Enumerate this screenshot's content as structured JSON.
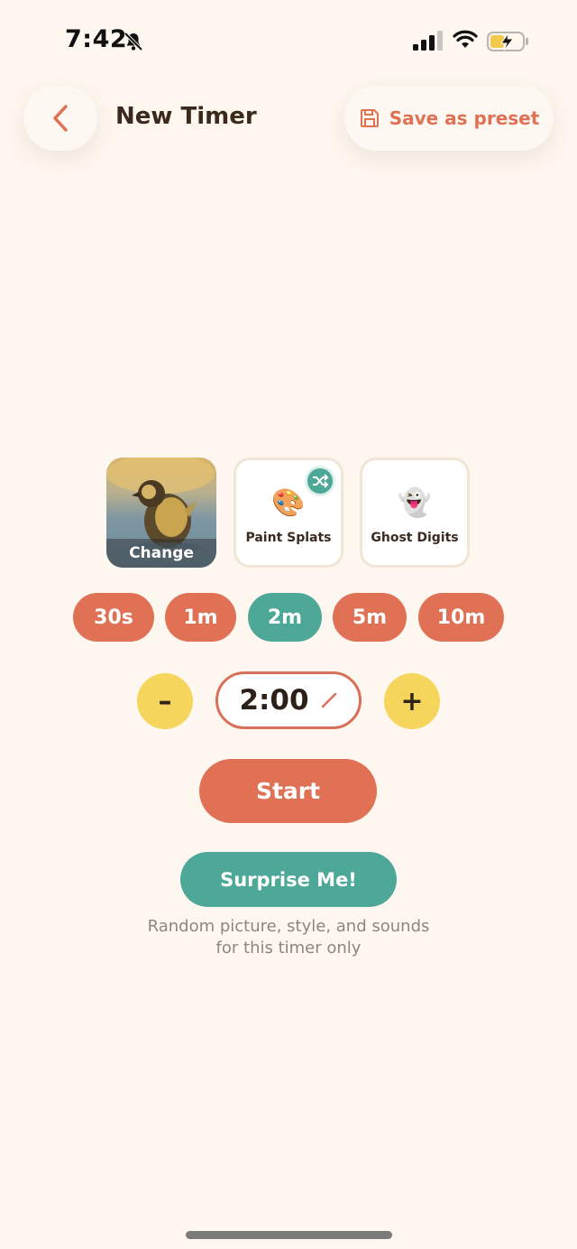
{
  "status_bar": {
    "time": "7:42",
    "icons": [
      "bell-slash-icon",
      "cellular-signal-icon",
      "wifi-icon",
      "battery-charging-icon"
    ]
  },
  "header": {
    "title": "New Timer",
    "back_icon": "chevron-left-icon",
    "save_preset_label": "Save as preset",
    "save_icon": "floppy-disk-icon"
  },
  "picture_tiles": [
    {
      "label": "Change",
      "kind": "photo",
      "description_icon": "duckling-photo"
    },
    {
      "label": "Paint Splats",
      "emoji": "🎨",
      "badge_icon": "shuffle-icon"
    },
    {
      "label": "Ghost Digits",
      "emoji": "👻"
    }
  ],
  "durations": {
    "options": [
      "30s",
      "1m",
      "2m",
      "5m",
      "10m"
    ],
    "selected": "2m"
  },
  "stepper": {
    "minus_label": "–",
    "plus_label": "+",
    "value": "2:00",
    "edit_icon": "pencil-icon"
  },
  "actions": {
    "start_label": "Start",
    "surprise_label": "Surprise Me!",
    "surprise_hint_line1": "Random picture, style, and sounds",
    "surprise_hint_line2": "for this timer only"
  },
  "colors": {
    "background": "#fdf7ef",
    "accent_coral": "#e07155",
    "accent_teal": "#4ea898",
    "accent_yellow": "#f6d55c",
    "text_dark": "#3b2a1c",
    "text_muted": "#8d857e"
  }
}
